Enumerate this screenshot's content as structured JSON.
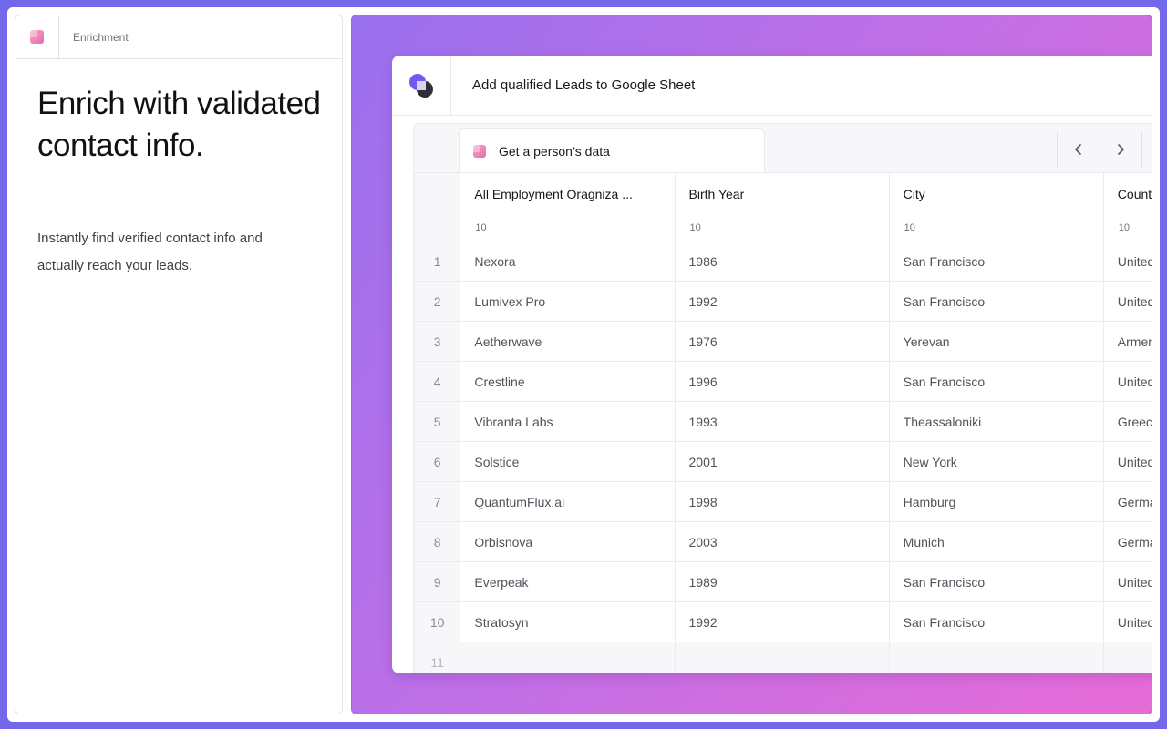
{
  "left": {
    "header_label": "Enrichment",
    "title": "Enrich with validated contact info.",
    "description": "Instantly find verified contact info and actually reach your leads."
  },
  "window": {
    "title": "Add qualified Leads to Google Sheet"
  },
  "sheet": {
    "tab_label": "Get a person’s data",
    "nav": {
      "prev_icon": "chevron-left-icon",
      "next_icon": "chevron-right-icon"
    },
    "columns": [
      {
        "label": "All Employment Oragniza ...",
        "count": "10"
      },
      {
        "label": "Birth Year",
        "count": "10"
      },
      {
        "label": "City",
        "count": "10"
      },
      {
        "label": "Country",
        "count": "10"
      }
    ],
    "rows": [
      {
        "idx": "1",
        "cells": [
          "Nexora",
          "1986",
          "San Francisco",
          "United States"
        ]
      },
      {
        "idx": "2",
        "cells": [
          "Lumivex Pro",
          "1992",
          "San Francisco",
          "United States"
        ]
      },
      {
        "idx": "3",
        "cells": [
          "Aetherwave",
          "1976",
          "Yerevan",
          "Armenia"
        ]
      },
      {
        "idx": "4",
        "cells": [
          "Crestline",
          "1996",
          "San Francisco",
          "United States"
        ]
      },
      {
        "idx": "5",
        "cells": [
          "Vibranta Labs",
          "1993",
          "Theassaloniki",
          "Greece"
        ]
      },
      {
        "idx": "6",
        "cells": [
          "Solstice",
          "2001",
          "New York",
          "United States"
        ]
      },
      {
        "idx": "7",
        "cells": [
          "QuantumFlux.ai",
          "1998",
          "Hamburg",
          "Germany"
        ]
      },
      {
        "idx": "8",
        "cells": [
          "Orbisnova",
          "2003",
          "Munich",
          "Germany"
        ]
      },
      {
        "idx": "9",
        "cells": [
          "Everpeak",
          "1989",
          "San Francisco",
          "United States"
        ]
      },
      {
        "idx": "10",
        "cells": [
          "Stratosyn",
          "1992",
          "San Francisco",
          "United States"
        ]
      }
    ],
    "empty_row_idx": "11"
  },
  "colors": {
    "background": "#7367ea",
    "gradient_start": "#9a70ee",
    "gradient_end": "#e86cd8",
    "accent": "#6d5cf0"
  }
}
